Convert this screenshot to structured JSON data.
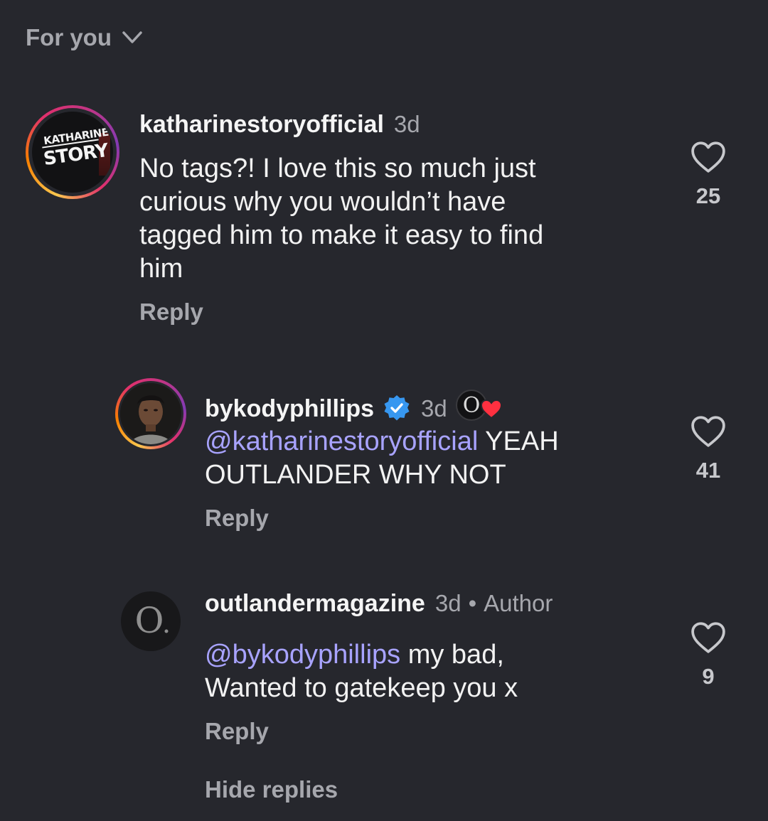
{
  "header": {
    "sort_label": "For you"
  },
  "comments": [
    {
      "username": "katharinestoryofficial",
      "time": "3d",
      "avatar_text_top": "KATHARINE",
      "avatar_text_bottom": "STORY",
      "lines": [
        "No tags?! I love this so much just",
        "curious why you wouldn’t have",
        "tagged him to make it easy to find",
        "him"
      ],
      "likes": "25",
      "reply_label": "Reply"
    },
    {
      "username": "bykodyphillips",
      "time": "3d",
      "mention": "@katharinestoryofficial",
      "lines": [
        " YEAH",
        "OUTLANDER WHY NOT"
      ],
      "likes": "41",
      "reply_label": "Reply"
    },
    {
      "username": "outlandermagazine",
      "time": "3d",
      "author_label": "Author",
      "mention": "@bykodyphillips",
      "lines": [
        " my bad,",
        "Wanted to gatekeep you x"
      ],
      "likes": "9",
      "reply_label": "Reply"
    }
  ],
  "hide_replies_label": "Hide replies",
  "colors": {
    "background": "#26272d",
    "mention": "#a8a3ff",
    "muted": "#a6a7ad",
    "verified": "#3797f0",
    "heart_red": "#ff3040"
  },
  "icons": [
    "chevron-down-icon",
    "heart-outline-icon",
    "verified-badge-icon",
    "liked-by-creator-heart-icon"
  ]
}
